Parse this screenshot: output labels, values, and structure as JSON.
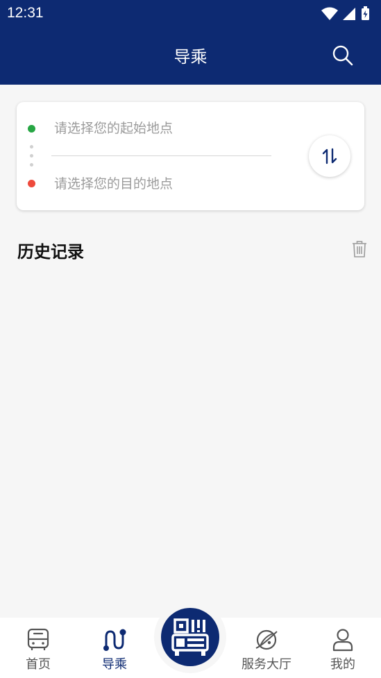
{
  "status_bar": {
    "time": "12:31"
  },
  "header": {
    "title": "导乘"
  },
  "route_card": {
    "start_placeholder": "请选择您的起始地点",
    "end_placeholder": "请选择您的目的地点"
  },
  "history": {
    "title": "历史记录"
  },
  "tabbar": {
    "home_label": "首页",
    "guide_label": "导乘",
    "service_label": "服务大厅",
    "mine_label": "我的"
  },
  "colors": {
    "brand": "#0d2a72",
    "start_dot": "#27a644",
    "end_dot": "#ee4a3c",
    "background": "#f6f6f6"
  },
  "icons": [
    "wifi-icon",
    "signal-icon",
    "battery-icon",
    "search-icon",
    "swap-icon",
    "trash-icon",
    "bus-icon",
    "route-icon",
    "qr-bus-icon",
    "planet-icon",
    "user-icon"
  ]
}
